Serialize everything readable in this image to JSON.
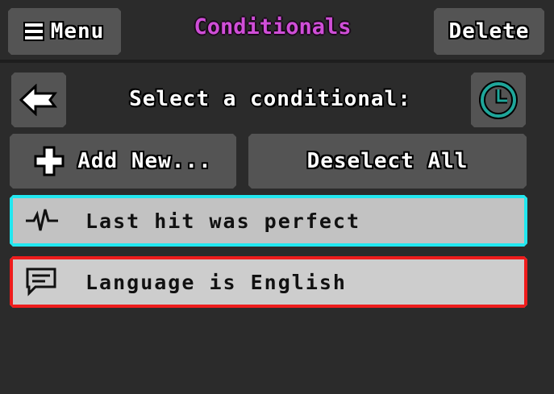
{
  "header": {
    "menu_label": "Menu",
    "title": "Conditionals",
    "delete_label": "Delete"
  },
  "selector": {
    "prompt": "Select a conditional:",
    "add_label": "Add New...",
    "deselect_label": "Deselect All"
  },
  "conditionals": [
    {
      "label": "Last hit was perfect",
      "icon": "pulse-icon",
      "outline_color": "#22e7ef"
    },
    {
      "label": "Language is English",
      "icon": "speech-bubble-icon",
      "outline_color": "#ee1c1c"
    }
  ],
  "icons": {
    "back": "back-arrow-icon",
    "clock": "clock-icon",
    "add": "plus-icon",
    "menu": "hamburger-icon"
  },
  "colors": {
    "title": "#d04ed8",
    "clock_accent": "#1fa69a",
    "selected_outline": "#22e7ef",
    "alt_outline": "#ee1c1c"
  }
}
